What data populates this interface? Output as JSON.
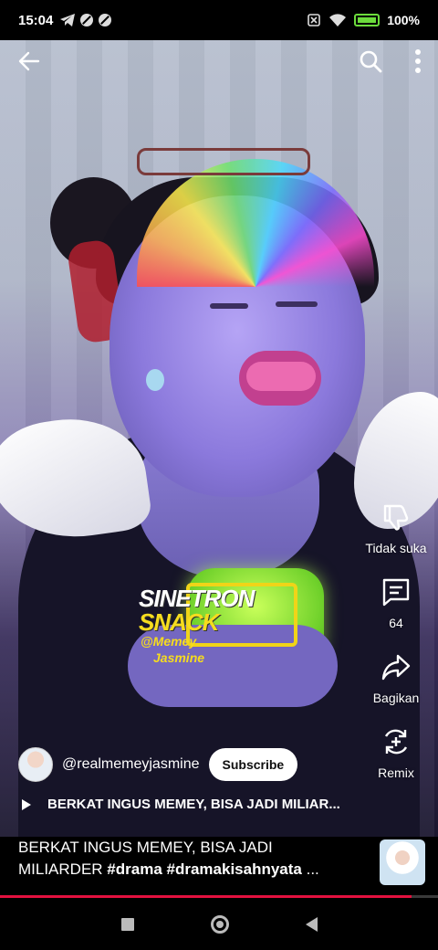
{
  "status": {
    "time": "15:04",
    "battery": "100%"
  },
  "icons": {
    "back": "arrow-left-icon",
    "search": "search-icon",
    "more": "more-vert-icon",
    "dislike": "thumbs-down-icon",
    "comment": "comment-icon",
    "share": "share-icon",
    "remix": "remix-icon"
  },
  "video_overlay": {
    "logo_line1": "SINETRON",
    "logo_line2": "SNACK",
    "logo_handle1": "@Memey",
    "logo_handle2": "Jasmine"
  },
  "actions": {
    "dislike_label": "Tidak suka",
    "comments_count": "64",
    "share_label": "Bagikan",
    "remix_label": "Remix"
  },
  "channel": {
    "handle": "@realmemeyjasmine",
    "subscribe_label": "Subscribe"
  },
  "video": {
    "title": "BERKAT INGUS MEMEY, BISA JADI MILIAR..."
  },
  "caption": {
    "text_line1": "BERKAT INGUS MEMEY, BISA JADI",
    "text_line2_plain": "MILIARDER ",
    "hashtag1": "#drama",
    "hashtag2": "#dramakisahnyata",
    "ellipsis": " ..."
  },
  "progress": {
    "fraction": 0.94
  },
  "colors": {
    "progress": "#e2113f",
    "logo_yellow": "#f6dc1e",
    "battery": "#6cdc3c"
  }
}
